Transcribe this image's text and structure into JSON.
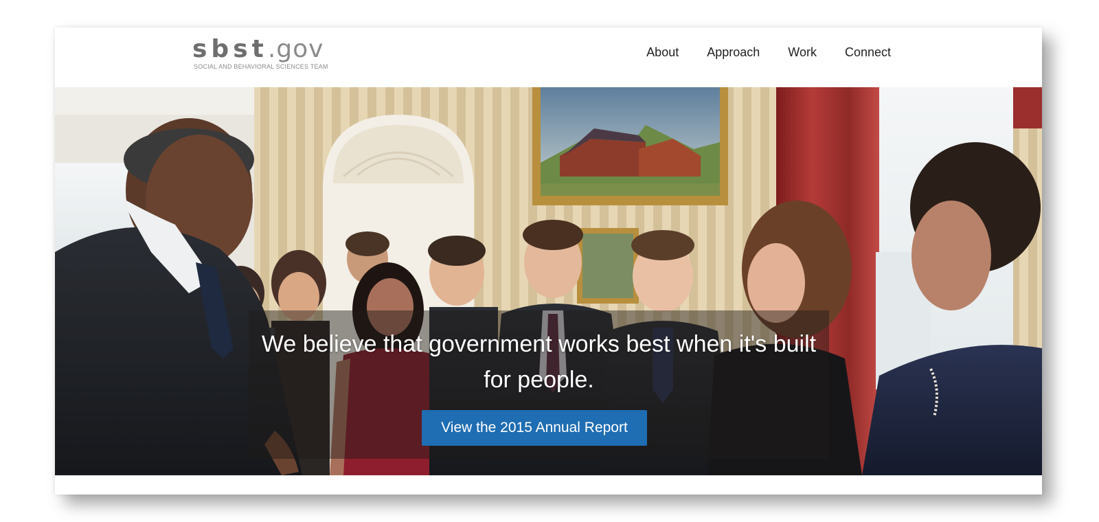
{
  "site": {
    "logo": {
      "name_bold": "sbst",
      "name_suffix": ".gov",
      "tagline": "SOCIAL AND BEHAVIORAL SCIENCES TEAM"
    },
    "nav": [
      {
        "label": "About"
      },
      {
        "label": "Approach"
      },
      {
        "label": "Work"
      },
      {
        "label": "Connect"
      }
    ]
  },
  "hero": {
    "headline": "We believe that government works best when it's built for people.",
    "cta_label": "View the 2015 Annual Report"
  },
  "colors": {
    "cta_blue": "#1f6db2",
    "nav_text": "#222222",
    "logo_gray": "#777777"
  }
}
